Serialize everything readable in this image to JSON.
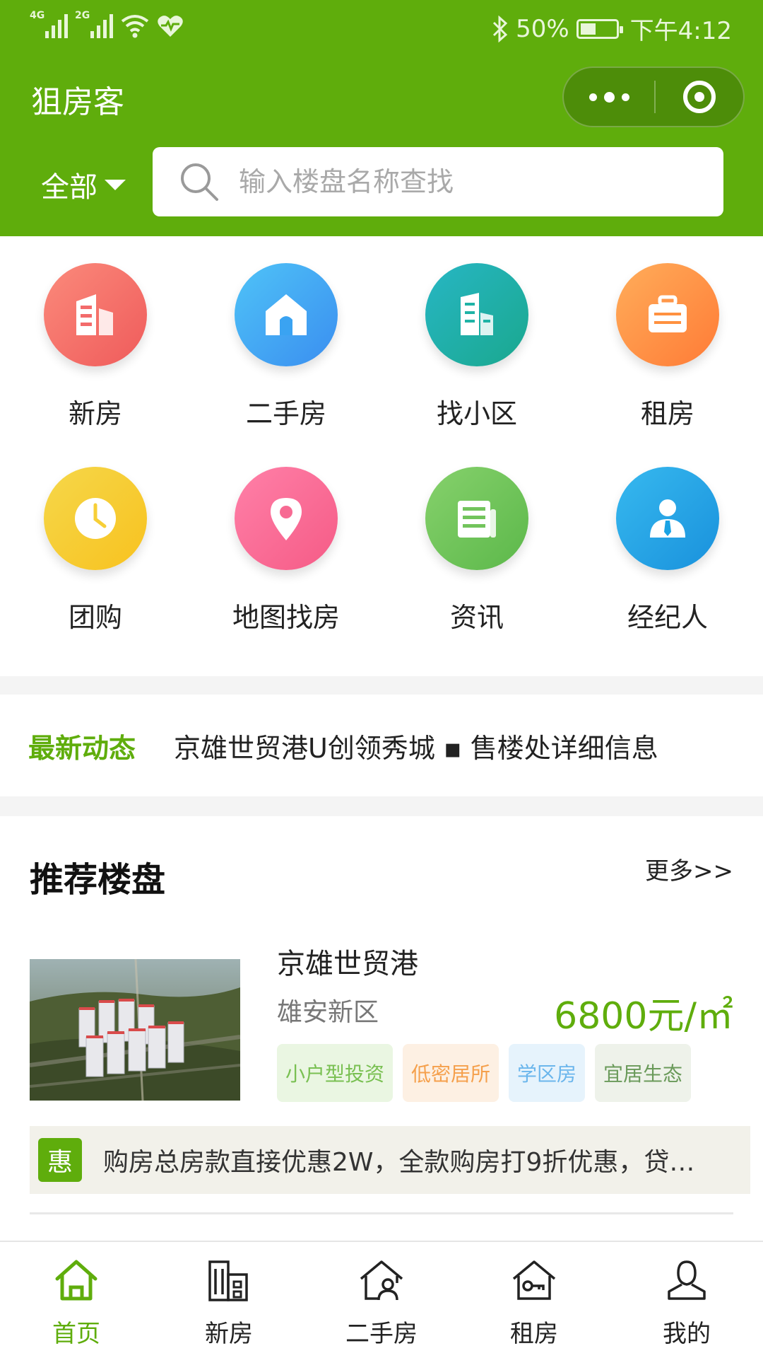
{
  "status_bar": {
    "signal1": "4G",
    "signal2": "2G",
    "battery_text": "50%",
    "battery_level": 0.5,
    "time": "下午4:12"
  },
  "header": {
    "title": "狙房客",
    "filter_label": "全部",
    "search_placeholder": "输入楼盘名称查找"
  },
  "categories": [
    {
      "label": "新房",
      "icon": "building-icon",
      "color": "#f36b6b"
    },
    {
      "label": "二手房",
      "icon": "house-icon",
      "color": "#3aa3f2"
    },
    {
      "label": "找小区",
      "icon": "community-icon",
      "color": "#1fb3a6"
    },
    {
      "label": "租房",
      "icon": "suitcase-icon",
      "color": "#ff9140"
    },
    {
      "label": "团购",
      "icon": "clock-icon",
      "color": "#f7cf37"
    },
    {
      "label": "地图找房",
      "icon": "map-pin-icon",
      "color": "#f76a93"
    },
    {
      "label": "资讯",
      "icon": "news-icon",
      "color": "#72c45c"
    },
    {
      "label": "经纪人",
      "icon": "agent-icon",
      "color": "#1aa3e4"
    }
  ],
  "news": {
    "tag": "最新动态",
    "text": "京雄世贸港U创领秀城 ▪ 售楼处详细信息"
  },
  "recommend": {
    "title": "推荐楼盘",
    "more": "更多>>",
    "property": {
      "name": "京雄世贸港",
      "area": "雄安新区",
      "price": "6800元/㎡",
      "tags": [
        {
          "text": "小户型投资",
          "color": "#79c052",
          "bg": "#eaf6e2"
        },
        {
          "text": "低密居所",
          "color": "#f5a04c",
          "bg": "#fdf0e3"
        },
        {
          "text": "学区房",
          "color": "#6bb6ec",
          "bg": "#e6f3fc"
        },
        {
          "text": "宜居生态",
          "color": "#6a9a5a",
          "bg": "#eef2ea"
        }
      ],
      "promo_badge": "惠",
      "promo_text": "购房总房款直接优惠2W，全款购房打9折优惠，贷…"
    }
  },
  "tabbar": [
    {
      "label": "首页",
      "icon": "home-icon",
      "active": true
    },
    {
      "label": "新房",
      "icon": "building-icon",
      "active": false
    },
    {
      "label": "二手房",
      "icon": "house-person-icon",
      "active": false
    },
    {
      "label": "租房",
      "icon": "house-key-icon",
      "active": false
    },
    {
      "label": "我的",
      "icon": "user-icon",
      "active": false
    }
  ],
  "colors": {
    "brand": "#5fad0c",
    "page_bg": "#f4f4f4"
  }
}
